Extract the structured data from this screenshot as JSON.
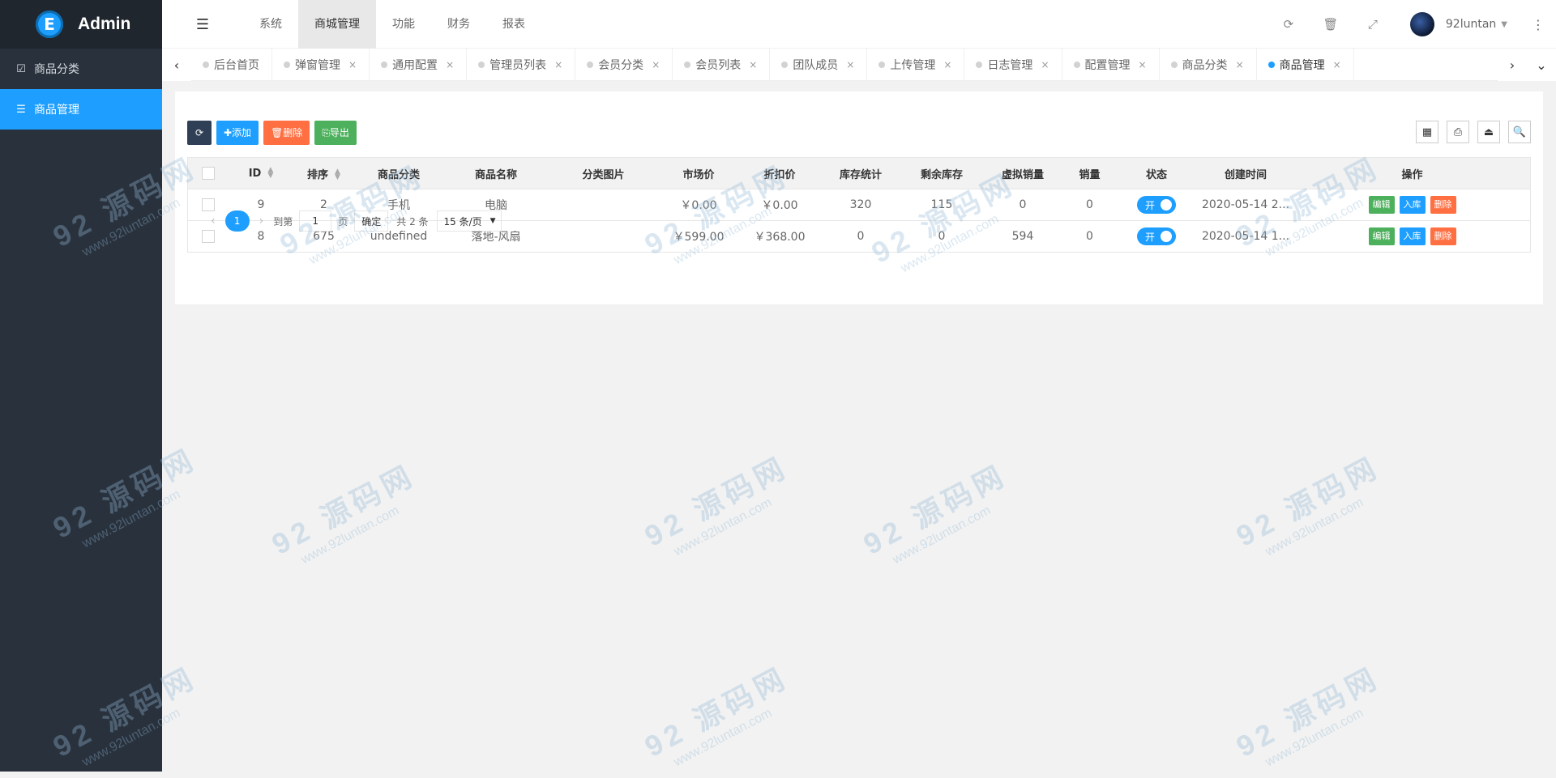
{
  "app": {
    "logo_letter": "E",
    "title": "Admin"
  },
  "sidebar": {
    "items": [
      {
        "label": "商品分类",
        "icon": "calendar-check-icon",
        "active": false
      },
      {
        "label": "商品管理",
        "icon": "list-icon",
        "active": true
      }
    ]
  },
  "topnav": {
    "fold_icon": "☰",
    "items": [
      {
        "label": "系统",
        "active": false
      },
      {
        "label": "商城管理",
        "active": true
      },
      {
        "label": "功能",
        "active": false
      },
      {
        "label": "财务",
        "active": false
      },
      {
        "label": "报表",
        "active": false
      }
    ]
  },
  "topright": {
    "refresh_icon": "⟳",
    "trash_icon": "🗑",
    "fullscreen_icon": "⤢",
    "username": "92luntan",
    "caret": "▼",
    "more_icon": "⋮"
  },
  "tabs": {
    "prev": "‹",
    "next": "›",
    "menu": "⌄",
    "items": [
      {
        "label": "后台首页",
        "closable": false,
        "active": false
      },
      {
        "label": "弹窗管理",
        "closable": true,
        "active": false
      },
      {
        "label": "通用配置",
        "closable": true,
        "active": false
      },
      {
        "label": "管理员列表",
        "closable": true,
        "active": false
      },
      {
        "label": "会员分类",
        "closable": true,
        "active": false
      },
      {
        "label": "会员列表",
        "closable": true,
        "active": false
      },
      {
        "label": "团队成员",
        "closable": true,
        "active": false
      },
      {
        "label": "上传管理",
        "closable": true,
        "active": false
      },
      {
        "label": "日志管理",
        "closable": true,
        "active": false
      },
      {
        "label": "配置管理",
        "closable": true,
        "active": false
      },
      {
        "label": "商品分类",
        "closable": true,
        "active": false
      },
      {
        "label": "商品管理",
        "closable": true,
        "active": true
      }
    ],
    "close_glyph": "×"
  },
  "toolbar": {
    "refresh_icon": "⟳",
    "add_label": "✚添加",
    "delete_label": "🗑删除",
    "export_label": "⎘导出"
  },
  "table_tools": {
    "columns_icon": "▦",
    "print_icon": "⎙",
    "export_icon": "⏏",
    "search_icon": "🔍"
  },
  "table": {
    "headers": [
      "ID",
      "排序",
      "商品分类",
      "商品名称",
      "分类图片",
      "市场价",
      "折扣价",
      "库存统计",
      "剩余库存",
      "虚拟销量",
      "销量",
      "状态",
      "创建时间",
      "操作"
    ],
    "rows": [
      {
        "id": "9",
        "sort": "2",
        "category": "手机",
        "name": "电脑",
        "image": "",
        "market_price": "￥0.00",
        "discount_price": "￥0.00",
        "stock_total": "320",
        "stock_left": "115",
        "virtual_sales": "0",
        "sales": "0",
        "status": "开",
        "created": "2020-05-14 2..."
      },
      {
        "id": "8",
        "sort": "675",
        "category": "undefined",
        "name": "落地-风扇",
        "image": "",
        "market_price": "￥599.00",
        "discount_price": "￥368.00",
        "stock_total": "0",
        "stock_left": "0",
        "virtual_sales": "594",
        "sales": "0",
        "status": "开",
        "created": "2020-05-14 1..."
      }
    ],
    "actions": {
      "edit": "编辑",
      "stock": "入库",
      "delete": "删除"
    }
  },
  "pager": {
    "prev": "‹",
    "current": "1",
    "next": "›",
    "goto_prefix": "到第",
    "goto_value": "1",
    "goto_suffix": "页",
    "confirm": "确定",
    "total": "共 2 条",
    "page_size": "15 条/页",
    "dropdown": "▼"
  },
  "watermark": {
    "brand": "92 源码网",
    "url": "www.92luntan.com"
  }
}
